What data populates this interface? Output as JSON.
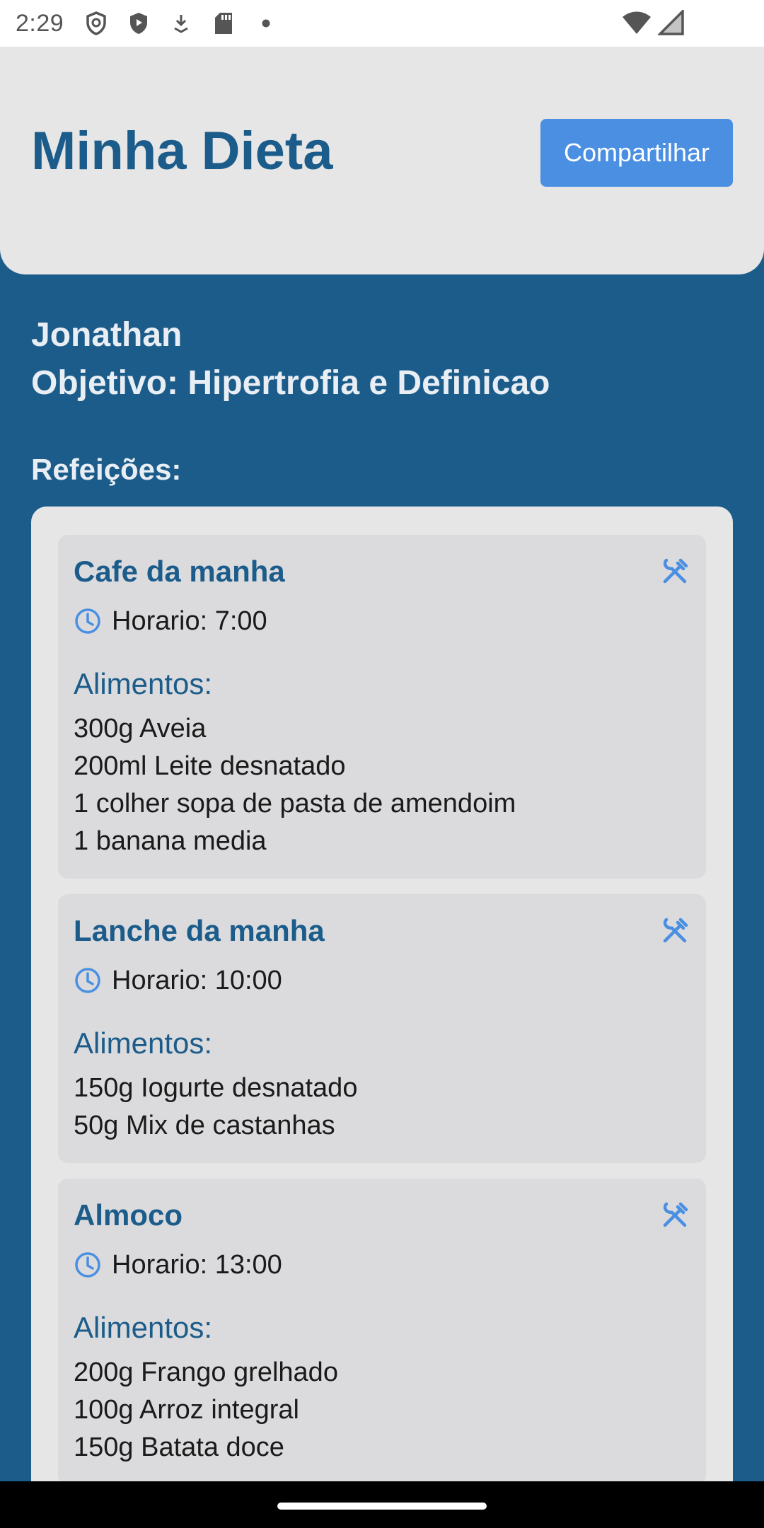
{
  "status_bar": {
    "time": "2:29",
    "icons": [
      "shield-outline-icon",
      "shield-filled-icon",
      "download-icon",
      "sd-card-icon",
      "dot-icon",
      "wifi-icon",
      "signal-icon"
    ]
  },
  "header": {
    "title": "Minha Dieta",
    "share_label": "Compartilhar"
  },
  "profile": {
    "name": "Jonathan",
    "goal": "Objetivo: Hipertrofia e Definicao"
  },
  "meals_heading": "Refeições:",
  "meals": [
    {
      "name": "Cafe da manha",
      "time": "Horario: 7:00",
      "foods_label": "Alimentos:",
      "foods": [
        "300g Aveia",
        "200ml Leite desnatado",
        "1 colher sopa de pasta de amendoim",
        "1 banana media"
      ]
    },
    {
      "name": "Lanche da manha",
      "time": "Horario: 10:00",
      "foods_label": "Alimentos:",
      "foods": [
        "150g Iogurte desnatado",
        "50g Mix de castanhas"
      ]
    },
    {
      "name": "Almoco",
      "time": "Horario: 13:00",
      "foods_label": "Alimentos:",
      "foods": [
        "200g Frango grelhado",
        "100g Arroz integral",
        "150g Batata doce"
      ]
    }
  ],
  "colors": {
    "primary": "#1b5c8a",
    "accent_button": "#4a8fe2",
    "icon_blue": "#4a8fe2",
    "header_bg": "#e6e6e6",
    "card_bg": "#dbdbdd"
  }
}
